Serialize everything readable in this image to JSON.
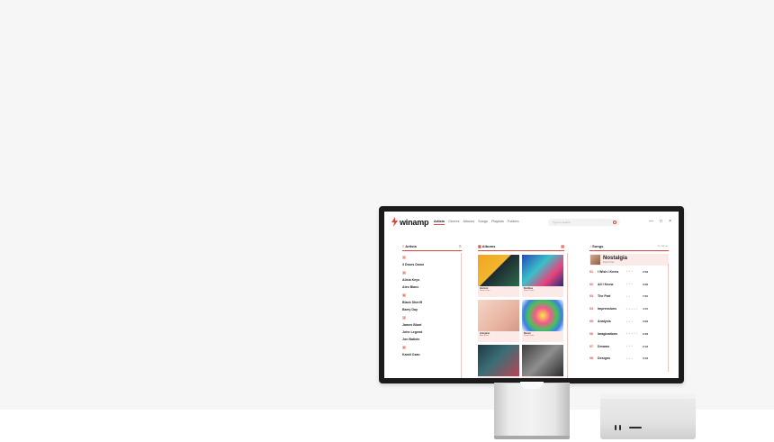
{
  "app": {
    "name": "winamp",
    "nav": [
      "Artists",
      "Genres",
      "Albums",
      "Songs",
      "Playlists",
      "Folders"
    ],
    "search_placeholder": "Type to search",
    "controls": [
      "—",
      "□",
      "×"
    ],
    "accent": "#e0443c"
  },
  "artists": {
    "heading": "Artists",
    "groups": [
      {
        "letter": "#",
        "names": [
          "3 Doors Down"
        ]
      },
      {
        "letter": "A",
        "names": [
          "Alicia Keys",
          "Alex Blanc"
        ]
      },
      {
        "letter": "B",
        "names": [
          "Black Sheriff",
          "Barry Day"
        ]
      },
      {
        "letter": "J",
        "names": [
          "James Blunt",
          "John Legend",
          "Jon Batiste"
        ]
      },
      {
        "letter": "K",
        "names": [
          "Kamil Ozan"
        ]
      }
    ]
  },
  "albums": {
    "heading": "Albums",
    "items": [
      {
        "title": "Horizon",
        "artist": "Kamil Ozan",
        "art": "linear-gradient(135deg,#f0a51e 0%,#f3b630 45%,#1d2a30 46%,#2f6b4c 100%)"
      },
      {
        "title": "Bodhisa",
        "artist": "Kamil Ozan",
        "art": "linear-gradient(135deg,#2848b8 0%,#39c0c8 40%,#e8427c 70%,#1f2d7a 100%)"
      },
      {
        "title": "Grandeur",
        "artist": "Alex Blanc",
        "art": "linear-gradient(135deg,#f5d4c6 0%,#e9b4a2 60%,#d49888 100%)"
      },
      {
        "title": "Bloom",
        "artist": "Kamil Ozan",
        "art": "radial-gradient(circle at 50% 50%,#ffe34c 0%,#f45a8a 30%,#46c25a 55%,#3c7ee4 75%,#ffffff 100%)"
      },
      {
        "title": "",
        "artist": "",
        "art": "linear-gradient(135deg,#1d3a44 0%,#3b6e78 45%,#b94452 100%)"
      },
      {
        "title": "",
        "artist": "",
        "art": "linear-gradient(135deg,#3e3e3e 0%,#8e8e8e 50%,#2b2b2b 100%)"
      }
    ]
  },
  "songs": {
    "heading": "Songs",
    "sort_label": "by Album",
    "now_playing": {
      "title": "Nostalgia",
      "artist": "Kamil Ozan"
    },
    "list": [
      {
        "num": "01",
        "title": "I Wish I Knew",
        "stars": "• • •",
        "dur": "2:58"
      },
      {
        "num": "02",
        "title": "All I Know",
        "stars": "• • •",
        "dur": "3:08"
      },
      {
        "num": "03",
        "title": "The Part",
        "stars": "• •",
        "dur": "7:00"
      },
      {
        "num": "04",
        "title": "Impressions",
        "stars": "• • • • •",
        "dur": "4:15"
      },
      {
        "num": "05",
        "title": "Analysis",
        "stars": "• • •",
        "dur": "3:08"
      },
      {
        "num": "06",
        "title": "Imaginations",
        "stars": "• • • • •",
        "dur": "2:28"
      },
      {
        "num": "07",
        "title": "Dreams",
        "stars": "• • •",
        "dur": "2:18"
      },
      {
        "num": "08",
        "title": "Designs",
        "stars": "• • •",
        "dur": "3:18"
      }
    ]
  }
}
